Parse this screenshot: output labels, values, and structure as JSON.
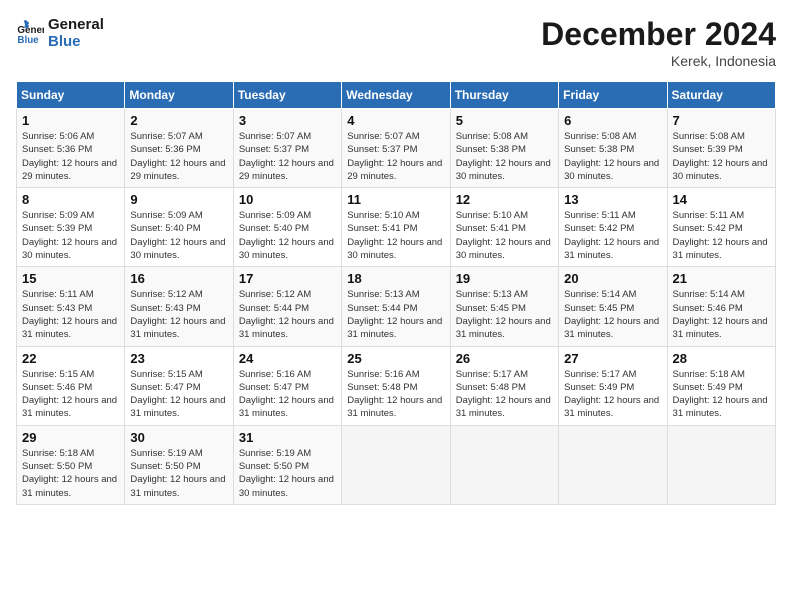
{
  "header": {
    "logo_line1": "General",
    "logo_line2": "Blue",
    "month_title": "December 2024",
    "location": "Kerek, Indonesia"
  },
  "days_of_week": [
    "Sunday",
    "Monday",
    "Tuesday",
    "Wednesday",
    "Thursday",
    "Friday",
    "Saturday"
  ],
  "weeks": [
    [
      {
        "day": 1,
        "sunrise": "5:06 AM",
        "sunset": "5:36 PM",
        "daylight": "12 hours and 29 minutes."
      },
      {
        "day": 2,
        "sunrise": "5:07 AM",
        "sunset": "5:36 PM",
        "daylight": "12 hours and 29 minutes."
      },
      {
        "day": 3,
        "sunrise": "5:07 AM",
        "sunset": "5:37 PM",
        "daylight": "12 hours and 29 minutes."
      },
      {
        "day": 4,
        "sunrise": "5:07 AM",
        "sunset": "5:37 PM",
        "daylight": "12 hours and 29 minutes."
      },
      {
        "day": 5,
        "sunrise": "5:08 AM",
        "sunset": "5:38 PM",
        "daylight": "12 hours and 30 minutes."
      },
      {
        "day": 6,
        "sunrise": "5:08 AM",
        "sunset": "5:38 PM",
        "daylight": "12 hours and 30 minutes."
      },
      {
        "day": 7,
        "sunrise": "5:08 AM",
        "sunset": "5:39 PM",
        "daylight": "12 hours and 30 minutes."
      }
    ],
    [
      {
        "day": 8,
        "sunrise": "5:09 AM",
        "sunset": "5:39 PM",
        "daylight": "12 hours and 30 minutes."
      },
      {
        "day": 9,
        "sunrise": "5:09 AM",
        "sunset": "5:40 PM",
        "daylight": "12 hours and 30 minutes."
      },
      {
        "day": 10,
        "sunrise": "5:09 AM",
        "sunset": "5:40 PM",
        "daylight": "12 hours and 30 minutes."
      },
      {
        "day": 11,
        "sunrise": "5:10 AM",
        "sunset": "5:41 PM",
        "daylight": "12 hours and 30 minutes."
      },
      {
        "day": 12,
        "sunrise": "5:10 AM",
        "sunset": "5:41 PM",
        "daylight": "12 hours and 30 minutes."
      },
      {
        "day": 13,
        "sunrise": "5:11 AM",
        "sunset": "5:42 PM",
        "daylight": "12 hours and 31 minutes."
      },
      {
        "day": 14,
        "sunrise": "5:11 AM",
        "sunset": "5:42 PM",
        "daylight": "12 hours and 31 minutes."
      }
    ],
    [
      {
        "day": 15,
        "sunrise": "5:11 AM",
        "sunset": "5:43 PM",
        "daylight": "12 hours and 31 minutes."
      },
      {
        "day": 16,
        "sunrise": "5:12 AM",
        "sunset": "5:43 PM",
        "daylight": "12 hours and 31 minutes."
      },
      {
        "day": 17,
        "sunrise": "5:12 AM",
        "sunset": "5:44 PM",
        "daylight": "12 hours and 31 minutes."
      },
      {
        "day": 18,
        "sunrise": "5:13 AM",
        "sunset": "5:44 PM",
        "daylight": "12 hours and 31 minutes."
      },
      {
        "day": 19,
        "sunrise": "5:13 AM",
        "sunset": "5:45 PM",
        "daylight": "12 hours and 31 minutes."
      },
      {
        "day": 20,
        "sunrise": "5:14 AM",
        "sunset": "5:45 PM",
        "daylight": "12 hours and 31 minutes."
      },
      {
        "day": 21,
        "sunrise": "5:14 AM",
        "sunset": "5:46 PM",
        "daylight": "12 hours and 31 minutes."
      }
    ],
    [
      {
        "day": 22,
        "sunrise": "5:15 AM",
        "sunset": "5:46 PM",
        "daylight": "12 hours and 31 minutes."
      },
      {
        "day": 23,
        "sunrise": "5:15 AM",
        "sunset": "5:47 PM",
        "daylight": "12 hours and 31 minutes."
      },
      {
        "day": 24,
        "sunrise": "5:16 AM",
        "sunset": "5:47 PM",
        "daylight": "12 hours and 31 minutes."
      },
      {
        "day": 25,
        "sunrise": "5:16 AM",
        "sunset": "5:48 PM",
        "daylight": "12 hours and 31 minutes."
      },
      {
        "day": 26,
        "sunrise": "5:17 AM",
        "sunset": "5:48 PM",
        "daylight": "12 hours and 31 minutes."
      },
      {
        "day": 27,
        "sunrise": "5:17 AM",
        "sunset": "5:49 PM",
        "daylight": "12 hours and 31 minutes."
      },
      {
        "day": 28,
        "sunrise": "5:18 AM",
        "sunset": "5:49 PM",
        "daylight": "12 hours and 31 minutes."
      }
    ],
    [
      {
        "day": 29,
        "sunrise": "5:18 AM",
        "sunset": "5:50 PM",
        "daylight": "12 hours and 31 minutes."
      },
      {
        "day": 30,
        "sunrise": "5:19 AM",
        "sunset": "5:50 PM",
        "daylight": "12 hours and 31 minutes."
      },
      {
        "day": 31,
        "sunrise": "5:19 AM",
        "sunset": "5:50 PM",
        "daylight": "12 hours and 30 minutes."
      },
      null,
      null,
      null,
      null
    ]
  ]
}
